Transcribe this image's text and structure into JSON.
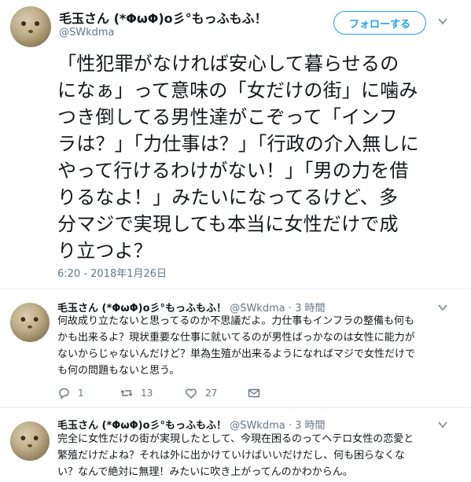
{
  "main": {
    "name": "毛玉さん (*ΦωΦ)o彡°もっふもふ！",
    "handle": "@SWkdma",
    "follow_label": "フォローする",
    "lines": [
      "「性犯罪がなければ安心して暮らせるの",
      "になぁ」って意味の「女だけの街」に噛み",
      "つき倒してる男性達がこぞって「インフ",
      "ラは？」「力仕事は？」「行政の介入無しに",
      "やって行けるわけがない！」「男の力を借",
      "りるなよ！」みたいになってるけど、多",
      "分マジで実現しても本当に女性だけで成",
      "り立つよ？"
    ],
    "timestamp": "6:20 - 2018年1月26日"
  },
  "replies": [
    {
      "name": "毛玉さん (*ΦωΦ)o彡°もっふもふ！",
      "meta": "@SWkdma · 3 時間",
      "lines": [
        "何故成り立たないと思ってるのか不思議だよ。力仕事もインフラの整備も何も",
        "かも出来るよ？現状重要な仕事に就いてるのが男性ばっかなのは女性に能力が",
        "ないからじゃないんだけど？単為生殖が出来るようになればマジで女性だけで",
        "も何の問題もないと思う。"
      ],
      "reply_count": "1",
      "retweet_count": "13",
      "like_count": "27"
    },
    {
      "name": "毛玉さん (*ΦωΦ)o彡°もっふもふ！",
      "meta": "@SWkdma · 3 時間",
      "lines": [
        "完全に女性だけの街が実現したとして、今現在困るのってヘテロ女性の恋愛と",
        "繁殖だけだよね？それは外に出かけていけばいいだけだし、何も困らなくな",
        "い？なんで絶対に無理！みたいに吹き上がってんのかわからん。"
      ]
    }
  ],
  "colors": {
    "accent": "#1da1f2",
    "muted": "#657786",
    "text": "#14171a"
  },
  "icons": [
    "caret-down-icon",
    "reply-icon",
    "retweet-icon",
    "like-icon",
    "dm-icon"
  ]
}
